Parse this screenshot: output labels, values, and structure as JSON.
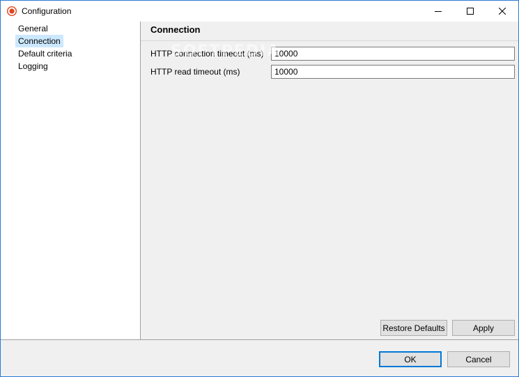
{
  "window": {
    "title": "Configuration",
    "icon": "app-record-icon",
    "accent_color": "#e0441f"
  },
  "sidebar": {
    "items": [
      {
        "label": "General",
        "selected": false
      },
      {
        "label": "Connection",
        "selected": true
      },
      {
        "label": "Default criteria",
        "selected": false
      },
      {
        "label": "Logging",
        "selected": false
      }
    ],
    "selected_color": "#cce8ff"
  },
  "main": {
    "section_title": "Connection",
    "fields": [
      {
        "label": "HTTP connection timeout (ms)",
        "value": "10000"
      },
      {
        "label": "HTTP read timeout (ms)",
        "value": "10000"
      }
    ],
    "restore_label": "Restore Defaults",
    "apply_label": "Apply"
  },
  "footer": {
    "ok_label": "OK",
    "cancel_label": "Cancel"
  },
  "watermark": "SOFTPEDIA"
}
